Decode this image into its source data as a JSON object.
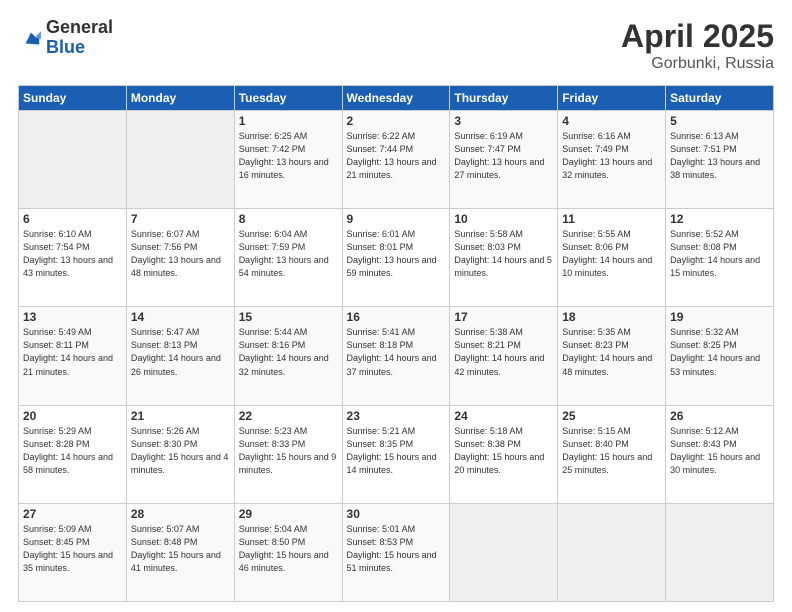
{
  "header": {
    "logo_general": "General",
    "logo_blue": "Blue",
    "title": "April 2025",
    "location": "Gorbunki, Russia"
  },
  "weekdays": [
    "Sunday",
    "Monday",
    "Tuesday",
    "Wednesday",
    "Thursday",
    "Friday",
    "Saturday"
  ],
  "weeks": [
    [
      {
        "day": "",
        "info": ""
      },
      {
        "day": "",
        "info": ""
      },
      {
        "day": "1",
        "info": "Sunrise: 6:25 AM\nSunset: 7:42 PM\nDaylight: 13 hours and 16 minutes."
      },
      {
        "day": "2",
        "info": "Sunrise: 6:22 AM\nSunset: 7:44 PM\nDaylight: 13 hours and 21 minutes."
      },
      {
        "day": "3",
        "info": "Sunrise: 6:19 AM\nSunset: 7:47 PM\nDaylight: 13 hours and 27 minutes."
      },
      {
        "day": "4",
        "info": "Sunrise: 6:16 AM\nSunset: 7:49 PM\nDaylight: 13 hours and 32 minutes."
      },
      {
        "day": "5",
        "info": "Sunrise: 6:13 AM\nSunset: 7:51 PM\nDaylight: 13 hours and 38 minutes."
      }
    ],
    [
      {
        "day": "6",
        "info": "Sunrise: 6:10 AM\nSunset: 7:54 PM\nDaylight: 13 hours and 43 minutes."
      },
      {
        "day": "7",
        "info": "Sunrise: 6:07 AM\nSunset: 7:56 PM\nDaylight: 13 hours and 48 minutes."
      },
      {
        "day": "8",
        "info": "Sunrise: 6:04 AM\nSunset: 7:59 PM\nDaylight: 13 hours and 54 minutes."
      },
      {
        "day": "9",
        "info": "Sunrise: 6:01 AM\nSunset: 8:01 PM\nDaylight: 13 hours and 59 minutes."
      },
      {
        "day": "10",
        "info": "Sunrise: 5:58 AM\nSunset: 8:03 PM\nDaylight: 14 hours and 5 minutes."
      },
      {
        "day": "11",
        "info": "Sunrise: 5:55 AM\nSunset: 8:06 PM\nDaylight: 14 hours and 10 minutes."
      },
      {
        "day": "12",
        "info": "Sunrise: 5:52 AM\nSunset: 8:08 PM\nDaylight: 14 hours and 15 minutes."
      }
    ],
    [
      {
        "day": "13",
        "info": "Sunrise: 5:49 AM\nSunset: 8:11 PM\nDaylight: 14 hours and 21 minutes."
      },
      {
        "day": "14",
        "info": "Sunrise: 5:47 AM\nSunset: 8:13 PM\nDaylight: 14 hours and 26 minutes."
      },
      {
        "day": "15",
        "info": "Sunrise: 5:44 AM\nSunset: 8:16 PM\nDaylight: 14 hours and 32 minutes."
      },
      {
        "day": "16",
        "info": "Sunrise: 5:41 AM\nSunset: 8:18 PM\nDaylight: 14 hours and 37 minutes."
      },
      {
        "day": "17",
        "info": "Sunrise: 5:38 AM\nSunset: 8:21 PM\nDaylight: 14 hours and 42 minutes."
      },
      {
        "day": "18",
        "info": "Sunrise: 5:35 AM\nSunset: 8:23 PM\nDaylight: 14 hours and 48 minutes."
      },
      {
        "day": "19",
        "info": "Sunrise: 5:32 AM\nSunset: 8:25 PM\nDaylight: 14 hours and 53 minutes."
      }
    ],
    [
      {
        "day": "20",
        "info": "Sunrise: 5:29 AM\nSunset: 8:28 PM\nDaylight: 14 hours and 58 minutes."
      },
      {
        "day": "21",
        "info": "Sunrise: 5:26 AM\nSunset: 8:30 PM\nDaylight: 15 hours and 4 minutes."
      },
      {
        "day": "22",
        "info": "Sunrise: 5:23 AM\nSunset: 8:33 PM\nDaylight: 15 hours and 9 minutes."
      },
      {
        "day": "23",
        "info": "Sunrise: 5:21 AM\nSunset: 8:35 PM\nDaylight: 15 hours and 14 minutes."
      },
      {
        "day": "24",
        "info": "Sunrise: 5:18 AM\nSunset: 8:38 PM\nDaylight: 15 hours and 20 minutes."
      },
      {
        "day": "25",
        "info": "Sunrise: 5:15 AM\nSunset: 8:40 PM\nDaylight: 15 hours and 25 minutes."
      },
      {
        "day": "26",
        "info": "Sunrise: 5:12 AM\nSunset: 8:43 PM\nDaylight: 15 hours and 30 minutes."
      }
    ],
    [
      {
        "day": "27",
        "info": "Sunrise: 5:09 AM\nSunset: 8:45 PM\nDaylight: 15 hours and 35 minutes."
      },
      {
        "day": "28",
        "info": "Sunrise: 5:07 AM\nSunset: 8:48 PM\nDaylight: 15 hours and 41 minutes."
      },
      {
        "day": "29",
        "info": "Sunrise: 5:04 AM\nSunset: 8:50 PM\nDaylight: 15 hours and 46 minutes."
      },
      {
        "day": "30",
        "info": "Sunrise: 5:01 AM\nSunset: 8:53 PM\nDaylight: 15 hours and 51 minutes."
      },
      {
        "day": "",
        "info": ""
      },
      {
        "day": "",
        "info": ""
      },
      {
        "day": "",
        "info": ""
      }
    ]
  ]
}
